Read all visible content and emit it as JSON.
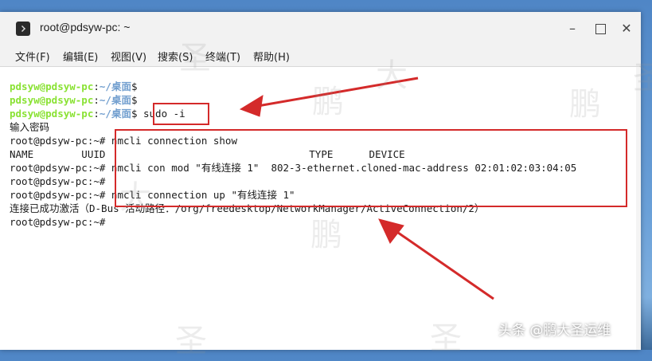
{
  "window": {
    "title": "root@pdsyw-pc: ~",
    "controls": {
      "minimize": "–",
      "maximize": "□",
      "close": "✕"
    }
  },
  "menu": [
    {
      "label": "文件(F)"
    },
    {
      "label": "编辑(E)"
    },
    {
      "label": "视图(V)"
    },
    {
      "label": "搜索(S)"
    },
    {
      "label": "终端(T)"
    },
    {
      "label": "帮助(H)"
    }
  ],
  "terminal": {
    "colors": {
      "user": "#8ae234",
      "path": "#729fcf",
      "highlight": "#d42a2a"
    },
    "lines": [
      {
        "user": "pdsyw@pdsyw-pc",
        "sep": ":",
        "path": "~/桌面",
        "prompt": "$",
        "cmd": ""
      },
      {
        "user": "pdsyw@pdsyw-pc",
        "sep": ":",
        "path": "~/桌面",
        "prompt": "$",
        "cmd": ""
      },
      {
        "user": "pdsyw@pdsyw-pc",
        "sep": ":",
        "path": "~/桌面",
        "prompt": "$",
        "cmd": " sudo -i"
      },
      {
        "text": "输入密码"
      },
      {
        "text": "root@pdsyw-pc:~# nmcli connection show"
      },
      {
        "text": "NAME        UUID                                  TYPE      DEVICE"
      },
      {
        "text": "root@pdsyw-pc:~# nmcli con mod \"有线连接 1\"  802-3-ethernet.cloned-mac-address 02:01:02:03:04:05"
      },
      {
        "text": "root@pdsyw-pc:~#"
      },
      {
        "text": "root@pdsyw-pc:~# nmcli connection up \"有线连接 1\""
      },
      {
        "text": "连接已成功激活（D-Bus 活动路径：/org/freedesktop/NetworkManager/ActiveConnection/2）"
      },
      {
        "text": "root@pdsyw-pc:~#"
      }
    ]
  },
  "watermark": "头条 @鹏大圣运维",
  "watermark_chars": [
    "圣",
    "大",
    "鹏",
    "圣",
    "鹏",
    "大",
    "鹏",
    "圣",
    "圣"
  ]
}
